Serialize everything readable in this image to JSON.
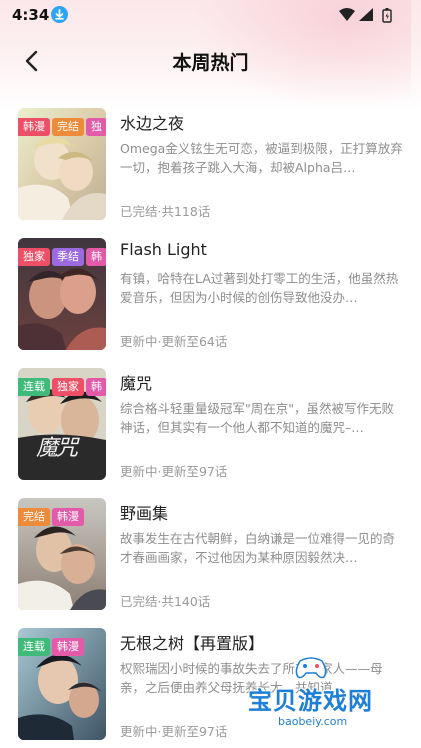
{
  "status_bar": {
    "time": "4:34"
  },
  "header": {
    "title": "本周热门"
  },
  "colors": {
    "tag_red": "#ee4f66",
    "tag_orange": "#ee8b3a",
    "tag_green": "#3fba79",
    "tag_pink": "#e35aa8",
    "tag_purple": "#9b6ae0",
    "accent_blue": "#1e7fd6"
  },
  "items": [
    {
      "title": "水边之夜",
      "description": "Omega金义铉生无可恋，被逼到极限，正打算放弃一切，抱着孩子跳入大海，却被Alpha吕…",
      "status": "已完结·共118话",
      "tags": [
        "韩漫",
        "完结",
        "独"
      ],
      "cover_caption": ""
    },
    {
      "title": "Flash Light",
      "description": "有镇，哈特在LA过著到处打零工的生活，他虽然热爱音乐，但因为小时候的创伤导致他没办…",
      "status": "更新中·更新至64话",
      "tags": [
        "独家",
        "季结",
        "韩"
      ],
      "cover_caption": ""
    },
    {
      "title": "魔咒",
      "description": "综合格斗轻重量级冠军\"周在京\"，虽然被写作无败神话，但其实有一个他人都不知道的魔咒–…",
      "status": "更新中·更新至97话",
      "tags": [
        "连载",
        "独家",
        "韩"
      ],
      "cover_caption": "魔咒"
    },
    {
      "title": "野画集",
      "description": "故事发生在古代朝鲜，白纳谦是一位难得一见的奇才春画画家，不过他因为某种原因毅然决…",
      "status": "已完结·共140话",
      "tags": [
        "完结",
        "韩漫"
      ],
      "cover_caption": ""
    },
    {
      "title": "无根之树【再置版】",
      "description": "权熙瑞因小时候的事故失去了所有的家人——母亲，之后便由养父母抚养长大，并知道…",
      "status": "更新中·更新至97话",
      "tags": [
        "连载",
        "韩漫"
      ],
      "cover_caption": ""
    }
  ],
  "watermark": {
    "text": "宝贝游戏网",
    "url": "baobeiy.com"
  }
}
